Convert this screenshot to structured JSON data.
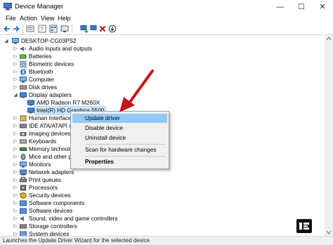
{
  "window": {
    "title": "Device Manager",
    "minimize_glyph": "—",
    "maximize_glyph": "☐",
    "close_glyph": "✕"
  },
  "menu": {
    "items": [
      "File",
      "Action",
      "View",
      "Help"
    ]
  },
  "toolbar": {
    "icons": [
      "back-arrow-icon",
      "forward-arrow-icon",
      "properties-icon",
      "help-icon",
      "view-toggle-icon",
      "scan-hardware-icon",
      "update-driver-icon",
      "uninstall-icon",
      "enable-device-icon"
    ]
  },
  "tree": {
    "root": "DESKTOP-CG03PS2",
    "categories": [
      "Audio inputs and outputs",
      "Batteries",
      "Biometric devices",
      "Bluetooth",
      "Computer",
      "Disk drives",
      "Display adapters",
      "Human Interface D",
      "IDE ATA/ATAPI cont",
      "Imaging devices",
      "Keyboards",
      "Memory technolog",
      "Mice and other poi",
      "Monitors",
      "Network adapters",
      "Print queues",
      "Processors",
      "Security devices",
      "Software components",
      "Software devices",
      "Sound, video and game controllers",
      "Storage controllers",
      "System devices"
    ],
    "display_children": [
      "AMD Radeon R7 M260X",
      "Intel(R) HD Graphics 5500"
    ],
    "selected": "Intel(R) HD Graphics 5500"
  },
  "context_menu": {
    "items": [
      "Update driver",
      "Disable device",
      "Uninstall device",
      "Scan for hardware changes",
      "Properties"
    ],
    "highlighted": "Update driver",
    "bold_item": "Properties"
  },
  "status_bar": {
    "text": "Launches the Update Driver Wizard for the selected device."
  },
  "colors": {
    "selection": "#cce8ff",
    "menu_highlight": "#91c9f7",
    "annotation_arrow": "#c0161c"
  }
}
